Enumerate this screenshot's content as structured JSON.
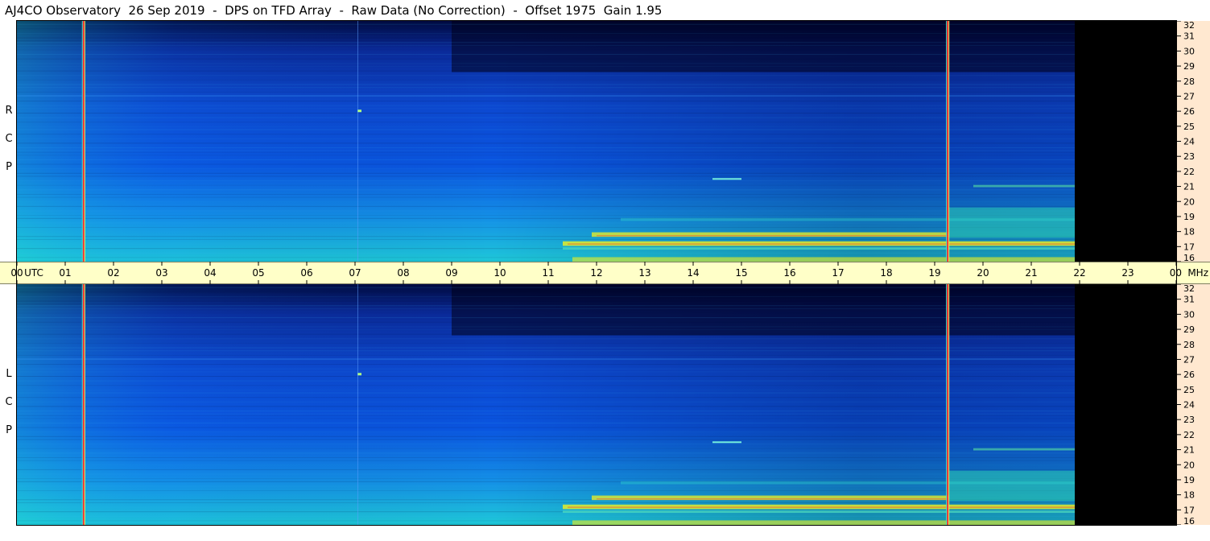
{
  "header": {
    "title": "AJ4CO Observatory  26 Sep 2019  -  DPS on TFD Array  -  Raw Data (No Correction)  -  Offset 1975  Gain 1.95"
  },
  "panels": {
    "top": {
      "polarization_label": "R C P"
    },
    "bottom": {
      "polarization_label": "L C P"
    }
  },
  "chart_data": {
    "type": "heatmap",
    "title": "AJ4CO Observatory  26 Sep 2019  -  DPS on TFD Array  -  Raw Data (No Correction)  -  Offset 1975  Gain 1.95",
    "x_axis": {
      "label": "UTC",
      "range_hours": [
        0,
        24
      ],
      "tick_labels": [
        "00",
        "01",
        "02",
        "03",
        "04",
        "05",
        "06",
        "07",
        "08",
        "09",
        "10",
        "11",
        "12",
        "13",
        "14",
        "15",
        "16",
        "17",
        "18",
        "19",
        "20",
        "21",
        "22",
        "23",
        "00"
      ]
    },
    "y_axis": {
      "label": "MHz",
      "range_mhz": [
        16,
        32
      ],
      "tick_labels": [
        "32",
        "31",
        "30",
        "29",
        "28",
        "27",
        "26",
        "25",
        "24",
        "23",
        "22",
        "21",
        "20",
        "19",
        "18",
        "17",
        "16"
      ]
    },
    "panels": [
      {
        "polarization": "R C P"
      },
      {
        "polarization": "L C P"
      }
    ],
    "data_coverage_hours": [
      0,
      21.9
    ],
    "colors": {
      "no_data": "#000000",
      "low": "#000a40",
      "mid": "#0a55e0",
      "high": "#1ec8d8",
      "peak": "#f0f020",
      "interference": "#ff3030"
    }
  }
}
